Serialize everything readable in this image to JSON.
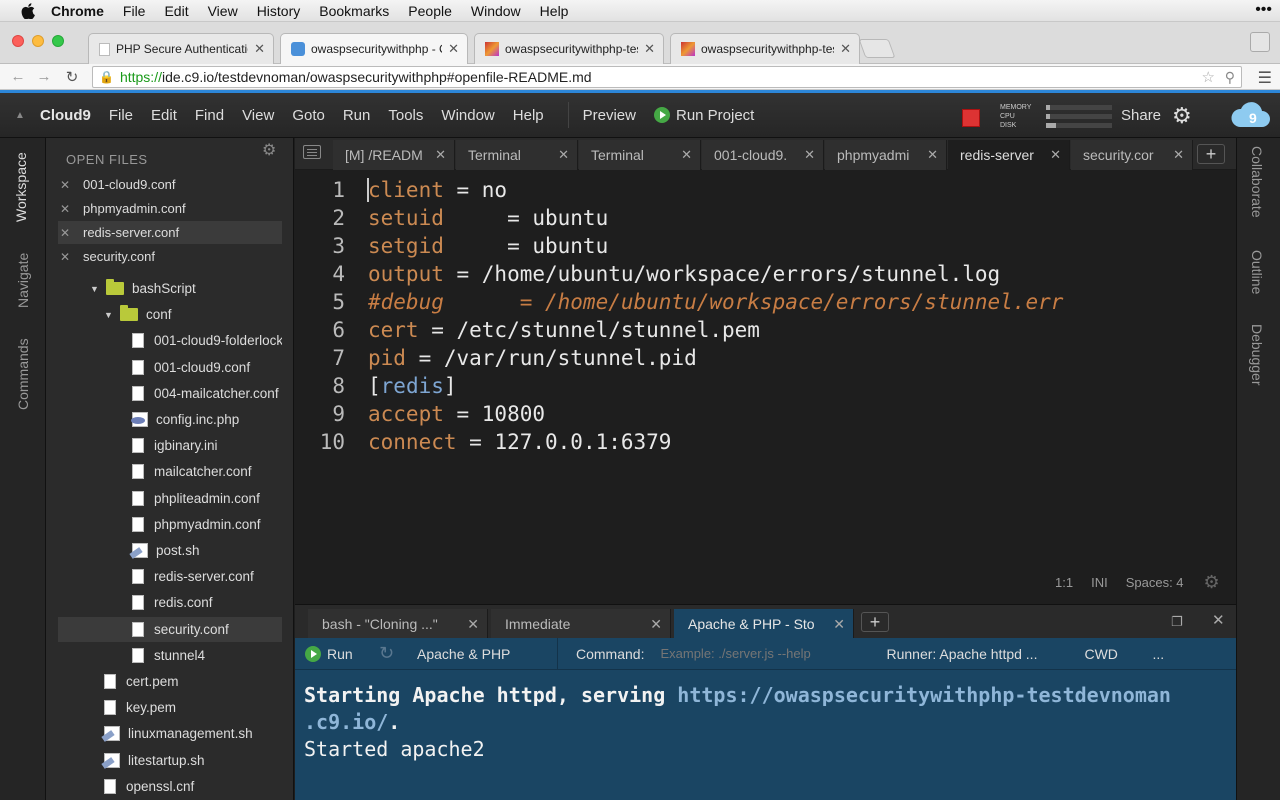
{
  "mac_menubar": {
    "items": [
      "Chrome",
      "File",
      "Edit",
      "View",
      "History",
      "Bookmarks",
      "People",
      "Window",
      "Help"
    ],
    "more": "•••"
  },
  "chrome": {
    "tabs": [
      {
        "title": "PHP Secure Authentication",
        "active": false
      },
      {
        "title": "owaspsecuritywithphp - Cl",
        "active": true
      },
      {
        "title": "owaspsecuritywithphp-test",
        "active": false
      },
      {
        "title": "owaspsecuritywithphp-test",
        "active": false
      }
    ],
    "url_scheme": "https://",
    "url_rest": "ide.c9.io/testdevnoman/owaspsecuritywithphp#openfile-README.md"
  },
  "c9_menubar": {
    "brand": "Cloud9",
    "items": [
      "File",
      "Edit",
      "Find",
      "View",
      "Goto",
      "Run",
      "Tools",
      "Window",
      "Help"
    ],
    "preview": "Preview",
    "run_project": "Run Project",
    "metrics": [
      {
        "label": "MEMORY",
        "level": 0.06
      },
      {
        "label": "CPU",
        "level": 0.06
      },
      {
        "label": "DISK",
        "level": 0.15
      }
    ],
    "share": "Share"
  },
  "left_rail": [
    "Workspace",
    "Navigate",
    "Commands"
  ],
  "right_rail": [
    "Collaborate",
    "Outline",
    "Debugger"
  ],
  "sidebar": {
    "open_files_title": "OPEN FILES",
    "open_files": [
      {
        "name": "001-cloud9.conf",
        "selected": false
      },
      {
        "name": "phpmyadmin.conf",
        "selected": false
      },
      {
        "name": "redis-server.conf",
        "selected": true
      },
      {
        "name": "security.conf",
        "selected": false
      }
    ],
    "tree": [
      {
        "name": "bashScript",
        "type": "folder",
        "depth": 0,
        "selected": false
      },
      {
        "name": "conf",
        "type": "folder",
        "depth": 1,
        "selected": false
      },
      {
        "name": "001-cloud9-folderlock",
        "type": "file",
        "depth": 2,
        "selected": false
      },
      {
        "name": "001-cloud9.conf",
        "type": "file",
        "depth": 2,
        "selected": false
      },
      {
        "name": "004-mailcatcher.conf",
        "type": "file",
        "depth": 2,
        "selected": false
      },
      {
        "name": "config.inc.php",
        "type": "php",
        "depth": 2,
        "selected": false
      },
      {
        "name": "igbinary.ini",
        "type": "file",
        "depth": 2,
        "selected": false
      },
      {
        "name": "mailcatcher.conf",
        "type": "file",
        "depth": 2,
        "selected": false
      },
      {
        "name": "phpliteadmin.conf",
        "type": "file",
        "depth": 2,
        "selected": false
      },
      {
        "name": "phpmyadmin.conf",
        "type": "file",
        "depth": 2,
        "selected": false
      },
      {
        "name": "post.sh",
        "type": "sh",
        "depth": 2,
        "selected": false
      },
      {
        "name": "redis-server.conf",
        "type": "file",
        "depth": 2,
        "selected": false
      },
      {
        "name": "redis.conf",
        "type": "file",
        "depth": 2,
        "selected": false
      },
      {
        "name": "security.conf",
        "type": "file",
        "depth": 2,
        "selected": true
      },
      {
        "name": "stunnel4",
        "type": "file",
        "depth": 2,
        "selected": false
      },
      {
        "name": "cert.pem",
        "type": "file",
        "depth": 1,
        "selected": false
      },
      {
        "name": "key.pem",
        "type": "file",
        "depth": 1,
        "selected": false
      },
      {
        "name": "linuxmanagement.sh",
        "type": "sh",
        "depth": 1,
        "selected": false
      },
      {
        "name": "litestartup.sh",
        "type": "sh",
        "depth": 1,
        "selected": false
      },
      {
        "name": "openssl.cnf",
        "type": "file",
        "depth": 1,
        "selected": false
      }
    ]
  },
  "editor_tabs": [
    {
      "title": "[M] /READM",
      "active": false
    },
    {
      "title": "Terminal",
      "active": false
    },
    {
      "title": "Terminal",
      "active": false
    },
    {
      "title": "001-cloud9.",
      "active": false
    },
    {
      "title": "phpmyadmi",
      "active": false
    },
    {
      "title": "redis-server",
      "active": true
    },
    {
      "title": "security.cor",
      "active": false
    }
  ],
  "editor": {
    "lines": [
      [
        {
          "t": "client",
          "c": "k"
        },
        {
          "t": " = no",
          "c": ""
        }
      ],
      [
        {
          "t": "setuid",
          "c": "k"
        },
        {
          "t": "     = ubuntu",
          "c": ""
        }
      ],
      [
        {
          "t": "setgid",
          "c": "k"
        },
        {
          "t": "     = ubuntu",
          "c": ""
        }
      ],
      [
        {
          "t": "output",
          "c": "k"
        },
        {
          "t": " = /home/ubuntu/workspace/errors/stunnel.log",
          "c": ""
        }
      ],
      [
        {
          "t": "#debug      = /home/ubuntu/workspace/errors/stunnel.err",
          "c": "c"
        }
      ],
      [
        {
          "t": "cert",
          "c": "k"
        },
        {
          "t": " = /etc/stunnel/stunnel.pem",
          "c": ""
        }
      ],
      [
        {
          "t": "pid",
          "c": "k"
        },
        {
          "t": " = /var/run/stunnel.pid",
          "c": ""
        }
      ],
      [
        {
          "t": "[",
          "c": ""
        },
        {
          "t": "redis",
          "c": "sec"
        },
        {
          "t": "]",
          "c": ""
        }
      ],
      [
        {
          "t": "accept",
          "c": "k"
        },
        {
          "t": " = 10800",
          "c": ""
        }
      ],
      [
        {
          "t": "connect",
          "c": "k"
        },
        {
          "t": " = 127.0.0.1:6379",
          "c": ""
        }
      ]
    ],
    "line_numbers": [
      "1",
      "2",
      "3",
      "4",
      "5",
      "6",
      "7",
      "8",
      "9",
      "10"
    ],
    "status_position": "1:1",
    "status_mode": "INI",
    "status_spaces": "Spaces: 4"
  },
  "panel": {
    "tabs": [
      {
        "title": "bash - \"Cloning ...\"",
        "active": false
      },
      {
        "title": "Immediate",
        "active": false
      },
      {
        "title": "Apache & PHP - Sto",
        "active": true
      }
    ],
    "run_label": "Run",
    "runner_name": "Apache & PHP",
    "command_label": "Command:",
    "command_placeholder": "Example: ./server.js --help",
    "runner_info": "Runner: Apache httpd ...",
    "cwd": "CWD",
    "more": "...",
    "terminal": {
      "line1_prefix": "Starting Apache httpd, serving ",
      "line1_link": "https://owaspsecuritywithphp-testdevnoman",
      "line2_link": ".c9.io/",
      "line2_suffix": ".",
      "line3": "Started apache2"
    }
  }
}
